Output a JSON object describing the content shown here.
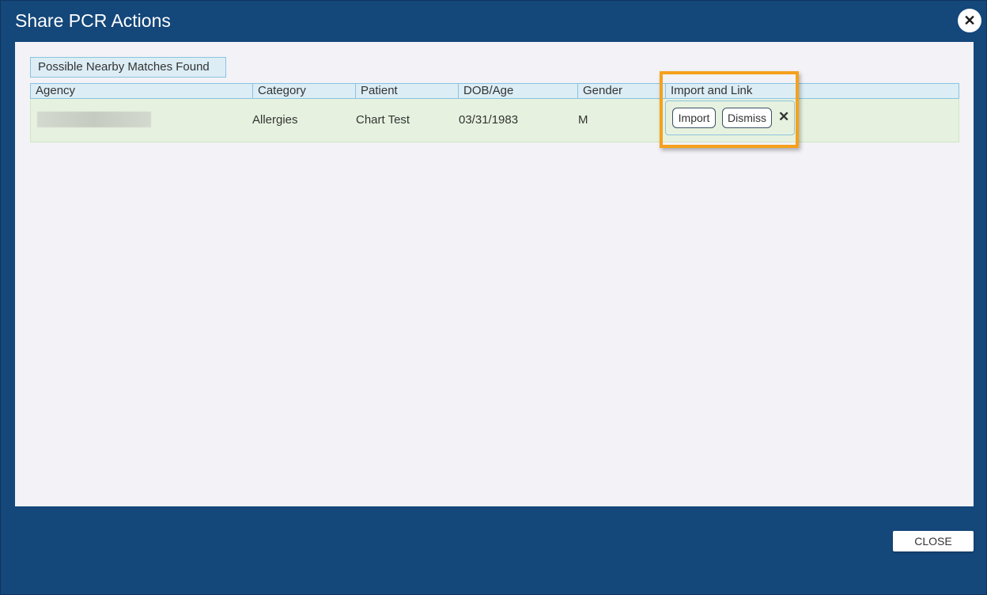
{
  "dialog": {
    "title": "Share PCR Actions",
    "close_icon": "close-icon"
  },
  "section": {
    "label": "Possible Nearby Matches Found"
  },
  "grid": {
    "columns": [
      "Agency",
      "Category",
      "Patient",
      "DOB/Age",
      "Gender",
      "Import and Link"
    ],
    "rows": [
      {
        "agency": "",
        "category": "Allergies",
        "patient": "Chart Test",
        "dob": "03/31/1983",
        "gender": "M",
        "import_label": "Import",
        "dismiss_label": "Dismiss",
        "remove_icon": "close-icon"
      }
    ]
  },
  "footer": {
    "close_label": "CLOSE"
  },
  "colors": {
    "frame": "#14477a",
    "panel": "#f2f2f7",
    "header": "#dcedf5",
    "row": "#e6f2df",
    "highlight": "#f5a11c"
  }
}
